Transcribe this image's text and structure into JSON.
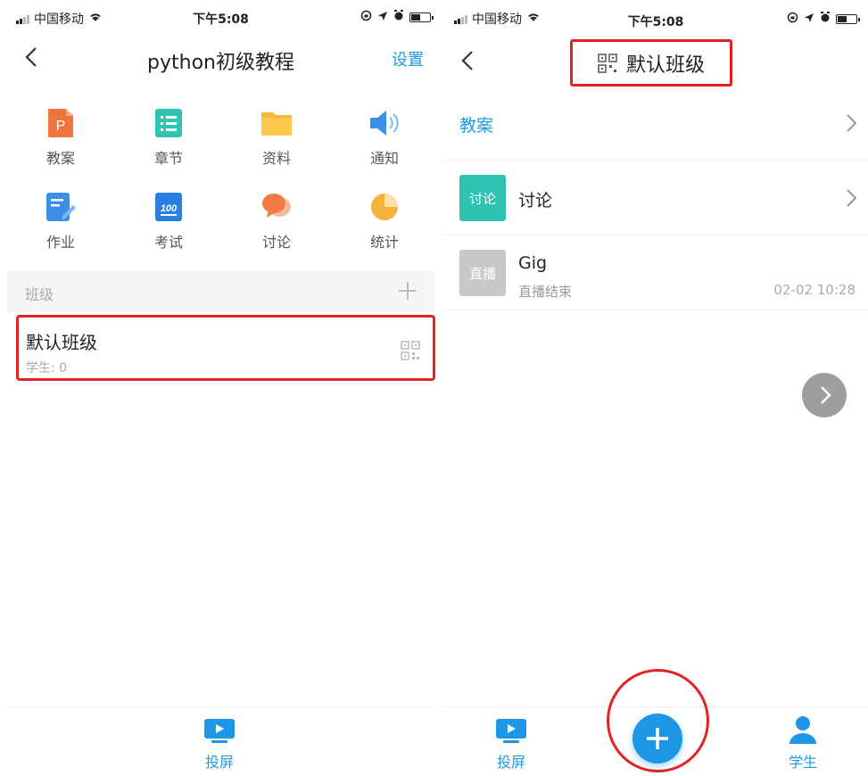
{
  "left": {
    "status": {
      "carrier": "中国移动",
      "time": "下午5:08"
    },
    "nav": {
      "title": "python初级教程",
      "action": "设置"
    },
    "grid": [
      {
        "label": "教案",
        "icon": "lesson-plan-icon"
      },
      {
        "label": "章节",
        "icon": "chapter-icon"
      },
      {
        "label": "资料",
        "icon": "folder-icon"
      },
      {
        "label": "通知",
        "icon": "speaker-icon"
      },
      {
        "label": "作业",
        "icon": "homework-icon"
      },
      {
        "label": "考试",
        "icon": "exam-icon"
      },
      {
        "label": "讨论",
        "icon": "discussion-icon"
      },
      {
        "label": "统计",
        "icon": "pie-chart-icon"
      }
    ],
    "section": {
      "title": "班级"
    },
    "class_card": {
      "name": "默认班级",
      "students": "学生: 0"
    },
    "tabbar": {
      "label": "投屏"
    }
  },
  "right": {
    "status": {
      "carrier": "中国移动",
      "time": "下午5:08"
    },
    "nav": {
      "title": "默认班级"
    },
    "rows": {
      "lesson": {
        "label": "教案"
      },
      "discussion": {
        "thumb": "讨论",
        "label": "讨论"
      },
      "live": {
        "thumb": "直播",
        "title": "Gig",
        "sub": "直播结束",
        "time": "02-02 10:28"
      }
    },
    "tabbar": {
      "left": "投屏",
      "right": "学生"
    }
  },
  "colors": {
    "accent": "#1e9be0",
    "highlight": "#e02424",
    "teal": "#2ec3b2",
    "orange": "#f08a38"
  }
}
